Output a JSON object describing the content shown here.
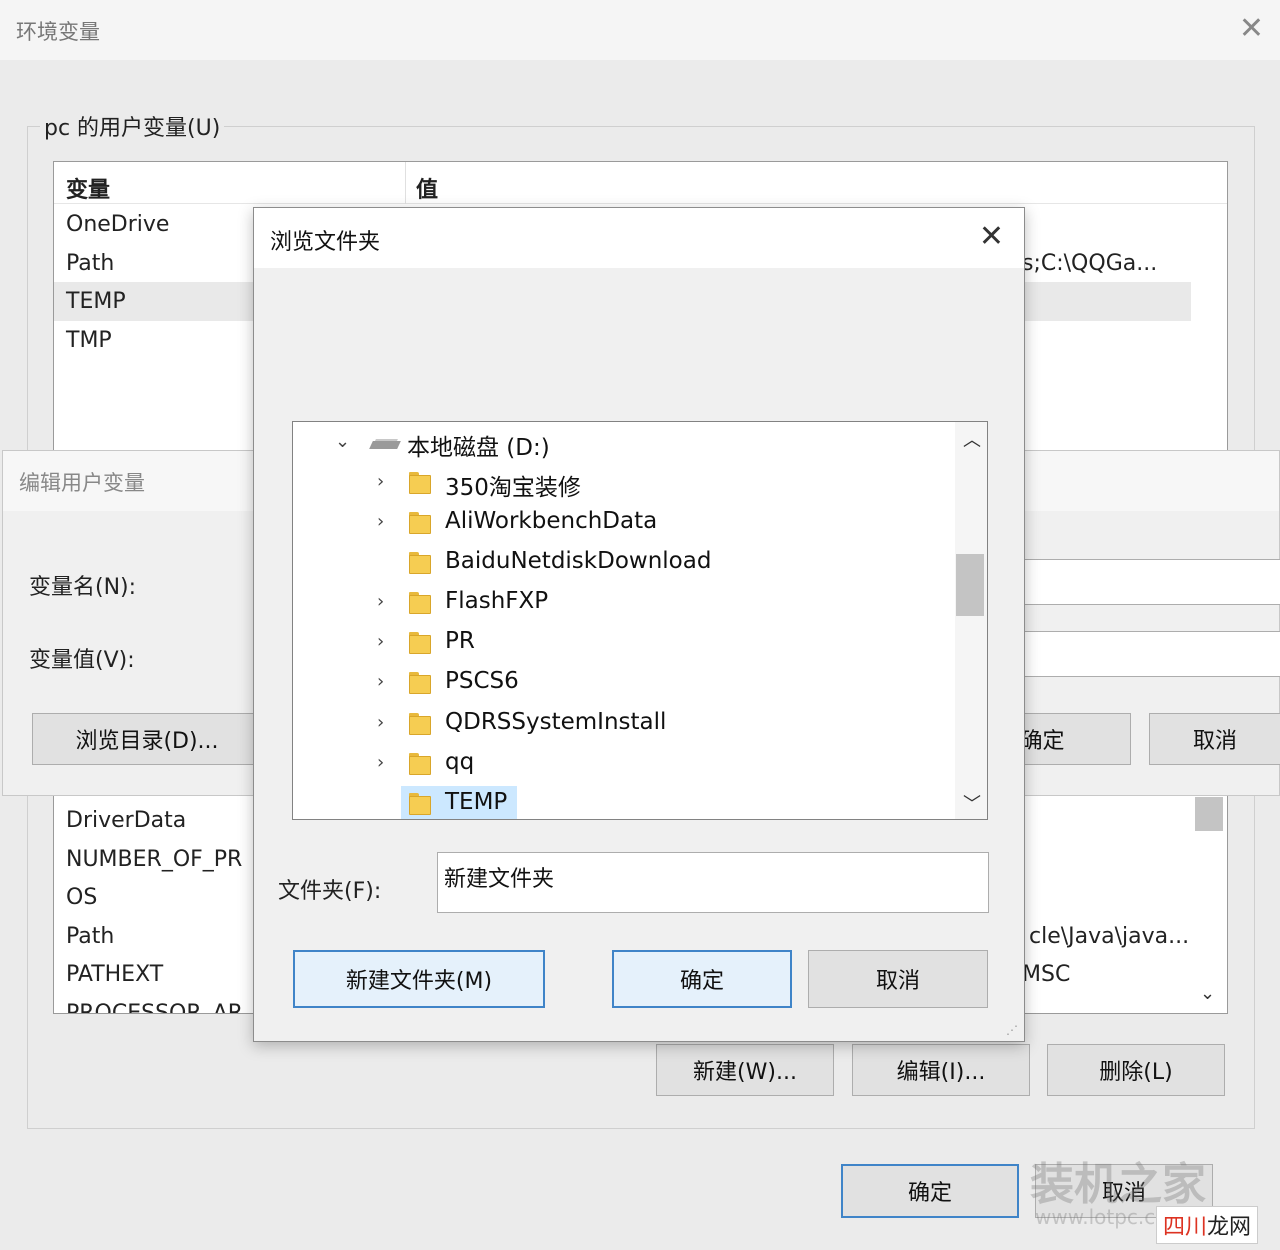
{
  "env_window": {
    "title": "环境变量",
    "user_group_label": "pc 的用户变量(U)",
    "user_table": {
      "headers": [
        "变量",
        "值"
      ],
      "rows": [
        {
          "name": "OneDrive",
          "value": ""
        },
        {
          "name": "Path",
          "value": "s;C:\\QQGa..."
        },
        {
          "name": "TEMP",
          "value": ""
        },
        {
          "name": "TMP",
          "value": ""
        }
      ],
      "selected_index": 2
    },
    "system_table": {
      "rows": [
        {
          "name": "DriverData",
          "value": ""
        },
        {
          "name": "NUMBER_OF_PR",
          "value": ""
        },
        {
          "name": "OS",
          "value": ""
        },
        {
          "name": "Path",
          "value": "cle\\Java\\java..."
        },
        {
          "name": "PATHEXT",
          "value": "MSC"
        },
        {
          "name": "PROCESSOR_AR",
          "value": ""
        }
      ]
    },
    "buttons": {
      "new": "新建(W)...",
      "edit": "编辑(I)...",
      "delete": "删除(L)",
      "ok": "确定",
      "cancel": "取消"
    }
  },
  "edit_window": {
    "title": "编辑用户变量",
    "name_label": "变量名(N):",
    "value_label": "变量值(V):",
    "browse_dir_button": "浏览目录(D)...",
    "ok_button": "确定",
    "cancel_button": "取消"
  },
  "browse_dialog": {
    "title": "浏览文件夹",
    "tree": {
      "root": "本地磁盘 (D:)",
      "items": [
        {
          "label": "350淘宝装修",
          "expandable": true
        },
        {
          "label": "AliWorkbenchData",
          "expandable": true
        },
        {
          "label": "BaiduNetdiskDownload",
          "expandable": false
        },
        {
          "label": "FlashFXP",
          "expandable": true
        },
        {
          "label": "PR",
          "expandable": true
        },
        {
          "label": "PSCS6",
          "expandable": true
        },
        {
          "label": "QDRSSystemInstall",
          "expandable": true
        },
        {
          "label": "qq",
          "expandable": true
        },
        {
          "label": "TEMP",
          "expandable": false,
          "selected": true
        }
      ]
    },
    "folder_label": "文件夹(F):",
    "folder_value": "新建文件夹",
    "new_folder_button": "新建文件夹(M)",
    "ok_button": "确定",
    "cancel_button": "取消"
  },
  "watermark": {
    "text": "装机之家",
    "url": "www.lotpc.com"
  },
  "badge": {
    "text_a": "四川",
    "text_b": "龙网"
  }
}
